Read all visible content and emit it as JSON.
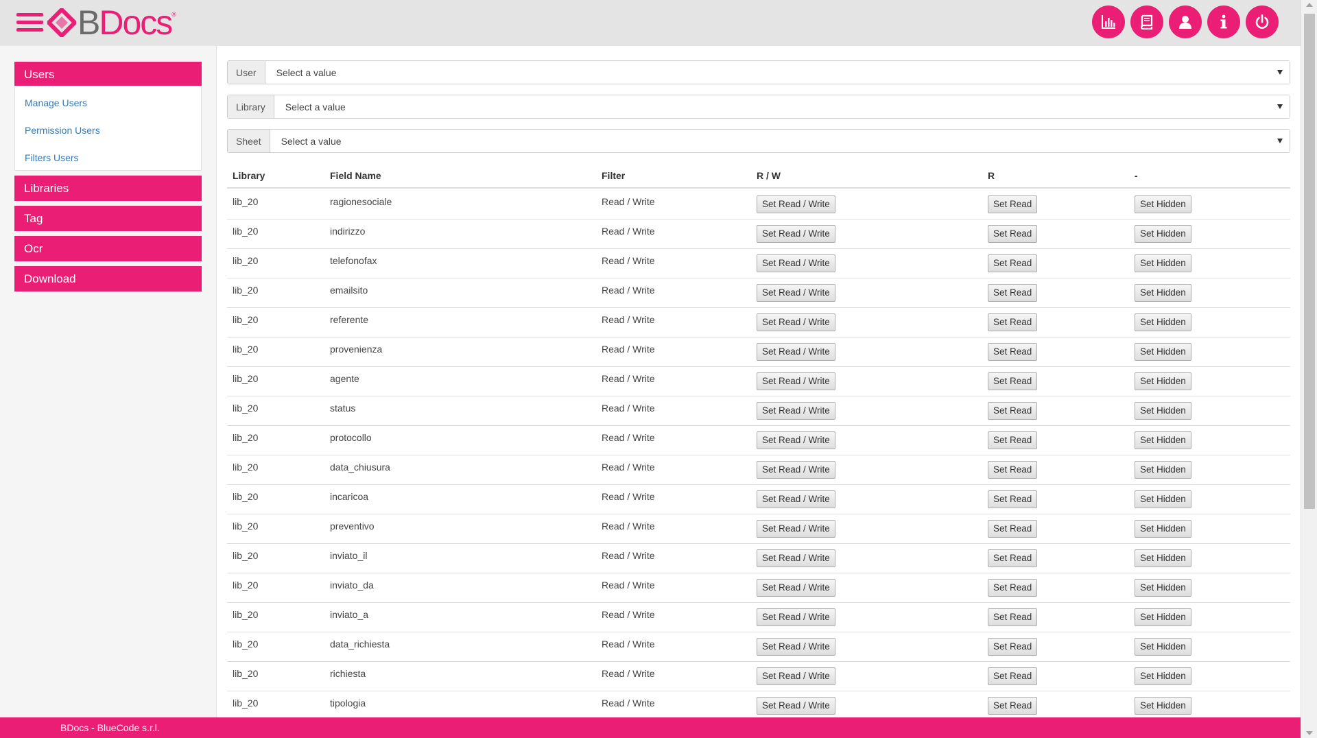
{
  "brand": {
    "logo_b": "B",
    "logo_docs": "Docs",
    "logo_reg": "®",
    "accent": "#e91e74"
  },
  "header_icons": [
    "chart-icon",
    "book-icon",
    "user-icon",
    "info-icon",
    "power-icon"
  ],
  "sidebar": {
    "users": {
      "label": "Users",
      "items": [
        "Manage Users",
        "Permission Users",
        "Filters Users"
      ]
    },
    "libraries": "Libraries",
    "tag": "Tag",
    "ocr": "Ocr",
    "download": "Download"
  },
  "filters": {
    "user": {
      "label": "User",
      "value": "Select a value"
    },
    "library": {
      "label": "Library",
      "value": "Select a value"
    },
    "sheet": {
      "label": "Sheet",
      "value": "Select a value"
    }
  },
  "table": {
    "headers": {
      "library": "Library",
      "field": "Field Name",
      "filter": "Filter",
      "rw": "R / W",
      "r": "R",
      "hidden": "-"
    },
    "buttons": {
      "rw": "Set Read / Write",
      "r": "Set Read",
      "hidden": "Set Hidden"
    },
    "rows": [
      {
        "library": "lib_20",
        "field": "ragionesociale",
        "filter": "Read / Write"
      },
      {
        "library": "lib_20",
        "field": "indirizzo",
        "filter": "Read / Write"
      },
      {
        "library": "lib_20",
        "field": "telefonofax",
        "filter": "Read / Write"
      },
      {
        "library": "lib_20",
        "field": "emailsito",
        "filter": "Read / Write"
      },
      {
        "library": "lib_20",
        "field": "referente",
        "filter": "Read / Write"
      },
      {
        "library": "lib_20",
        "field": "provenienza",
        "filter": "Read / Write"
      },
      {
        "library": "lib_20",
        "field": "agente",
        "filter": "Read / Write"
      },
      {
        "library": "lib_20",
        "field": "status",
        "filter": "Read / Write"
      },
      {
        "library": "lib_20",
        "field": "protocollo",
        "filter": "Read / Write"
      },
      {
        "library": "lib_20",
        "field": "data_chiusura",
        "filter": "Read / Write"
      },
      {
        "library": "lib_20",
        "field": "incaricoa",
        "filter": "Read / Write"
      },
      {
        "library": "lib_20",
        "field": "preventivo",
        "filter": "Read / Write"
      },
      {
        "library": "lib_20",
        "field": "inviato_il",
        "filter": "Read / Write"
      },
      {
        "library": "lib_20",
        "field": "inviato_da",
        "filter": "Read / Write"
      },
      {
        "library": "lib_20",
        "field": "inviato_a",
        "filter": "Read / Write"
      },
      {
        "library": "lib_20",
        "field": "data_richiesta",
        "filter": "Read / Write"
      },
      {
        "library": "lib_20",
        "field": "richiesta",
        "filter": "Read / Write"
      },
      {
        "library": "lib_20",
        "field": "tipologia",
        "filter": "Read / Write"
      }
    ]
  },
  "footer": {
    "text": "BDocs - BlueCode s.r.l."
  }
}
